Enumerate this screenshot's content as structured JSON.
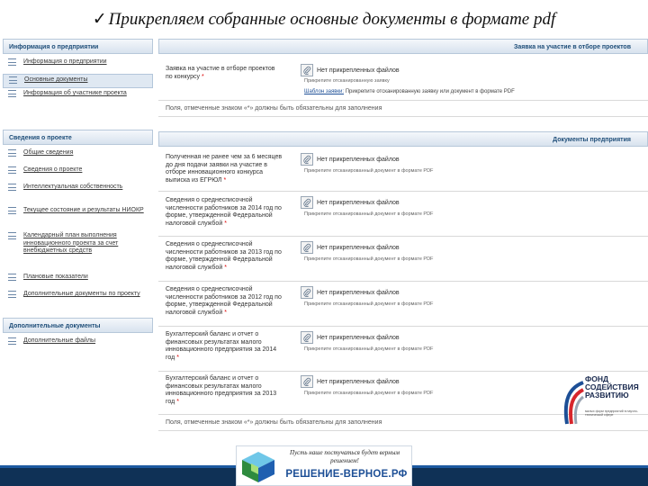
{
  "slide": {
    "title": "Прикрепляем собранные основные документы в формате pdf",
    "check": "✓"
  },
  "sidebar": {
    "sections": [
      {
        "title": "Информация о предприятии",
        "items": [
          {
            "label": "Информация о предприятии",
            "active": false
          },
          {
            "label": "Основные документы",
            "active": true
          },
          {
            "label": "Информация об участнике проекта",
            "active": false
          }
        ]
      },
      {
        "title": "Сведения о проекте",
        "items": [
          {
            "label": "Общие сведения",
            "active": false
          },
          {
            "label": "Сведения о проекте",
            "active": false
          },
          {
            "label": "Интеллектуальная собственность",
            "active": false
          },
          {
            "label": "Текущее состояние и результаты НИОКР",
            "active": false
          },
          {
            "label": "Календарный план выполнения инновационного проекта за счет внебюджетных средств",
            "active": false
          },
          {
            "label": "Плановые показатели",
            "active": false
          },
          {
            "label": "Дополнительные документы по проекту",
            "active": false
          }
        ]
      },
      {
        "title": "Дополнительные документы",
        "items": [
          {
            "label": "Дополнительные файлы",
            "active": false
          }
        ]
      }
    ]
  },
  "main": {
    "application": {
      "header": "Заявка на участие в отборе проектов",
      "row": {
        "label": "Заявка на участие в отборе проектов по конкурсу",
        "req": "*",
        "no_file": "Нет прикрепленных файлов",
        "hint": "Прикрепите отсканированную заявку",
        "template_link": "Шаблон заявки:",
        "template_text": "Прикрепите отсканированную заявку или документ в формате PDF"
      },
      "note": "Поля, отмеченные знаком «*» должны быть обязательны для заполнения"
    },
    "docs": {
      "header": "Документы предприятия",
      "rows": [
        {
          "label": "Полученная не ранее чем за 6 месяцев до дня подачи заявки на участие в отборе инновационного конкурса выписка из ЕГРЮЛ",
          "req": "*",
          "no_file": "Нет прикрепленных файлов",
          "hint": "Прикрепите отсканированный документ в формате PDF"
        },
        {
          "label": "Сведения о среднесписочной численности работников за 2014 год по форме, утвержденной Федеральной налоговой службой",
          "req": "*",
          "no_file": "Нет прикрепленных файлов",
          "hint": "Прикрепите отсканированный документ в формате PDF"
        },
        {
          "label": "Сведения о среднесписочной численности работников за 2013 год по форме, утвержденной Федеральной налоговой службой",
          "req": "*",
          "no_file": "Нет прикрепленных файлов",
          "hint": "Прикрепите отсканированный документ в формате PDF"
        },
        {
          "label": "Сведения о среднесписочной численности работников за 2012 год по форме, утвержденной Федеральной налоговой службой",
          "req": "*",
          "no_file": "Нет прикрепленных файлов",
          "hint": "Прикрепите отсканированный документ в формате PDF"
        },
        {
          "label": "Бухгалтерский баланс и отчет о финансовых результатах малого инновационного предприятия за 2014 год",
          "req": "*",
          "no_file": "Нет прикрепленных файлов",
          "hint": "Прикрепите отсканированный документ в формате PDF"
        },
        {
          "label": "Бухгалтерский баланс и отчет о финансовых результатах малого инновационного предприятия за 2013 год",
          "req": "*",
          "no_file": "Нет прикрепленных файлов",
          "hint": "Прикрепите отсканированный документ в формате PDF"
        }
      ],
      "note": "Поля, отмеченные знаком «*» должны быть обязательны для заполнения"
    }
  },
  "logo": {
    "line1": "ФОНД",
    "line2": "СОДЕЙСТВИЯ",
    "line3": "РАЗВИТИЮ",
    "sub": "малых форм предприятий в научно-технической сфере"
  },
  "footer": {
    "slogan": "Пусть наше постучаться будет верным решением!",
    "site": "РЕШЕНИЕ-ВЕРНОЕ.РФ"
  },
  "colors": {
    "header_text": "#1f4e79",
    "link": "#1d4f96",
    "required": "#d00000",
    "footer_bar": "#0f3156"
  }
}
